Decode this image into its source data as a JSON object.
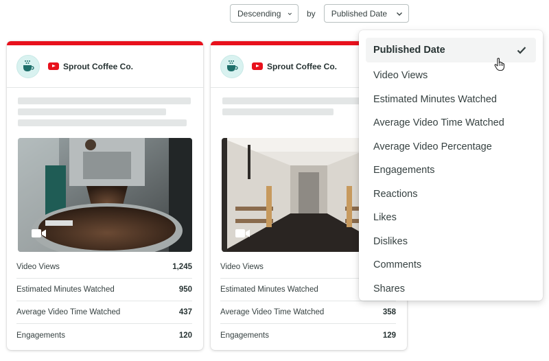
{
  "sort": {
    "order": "Descending",
    "by": "by",
    "field": "Published Date"
  },
  "cards": [
    {
      "profile": "Sprout Coffee Co.",
      "metrics": [
        {
          "label": "Video Views",
          "value": "1,245"
        },
        {
          "label": "Estimated Minutes Watched",
          "value": "950"
        },
        {
          "label": "Average Video Time Watched",
          "value": "437"
        },
        {
          "label": "Engagements",
          "value": "120"
        }
      ]
    },
    {
      "profile": "Sprout Coffee Co.",
      "metrics": [
        {
          "label": "Video Views",
          "value": ""
        },
        {
          "label": "Estimated Minutes Watched",
          "value": ""
        },
        {
          "label": "Average Video Time Watched",
          "value": "358"
        },
        {
          "label": "Engagements",
          "value": "129"
        }
      ]
    }
  ],
  "dropdown": {
    "items": [
      "Published Date",
      "Video Views",
      "Estimated Minutes Watched",
      "Average Video Time Watched",
      "Average Video Percentage",
      "Engagements",
      "Reactions",
      "Likes",
      "Dislikes",
      "Comments",
      "Shares"
    ],
    "selected_index": 0
  },
  "colors": {
    "accent_red": "#e8111c",
    "text": "#364141",
    "divider": "#e3e6e6",
    "avatar_bg": "#d9f2f0",
    "selected_bg": "#f3f4f4"
  }
}
